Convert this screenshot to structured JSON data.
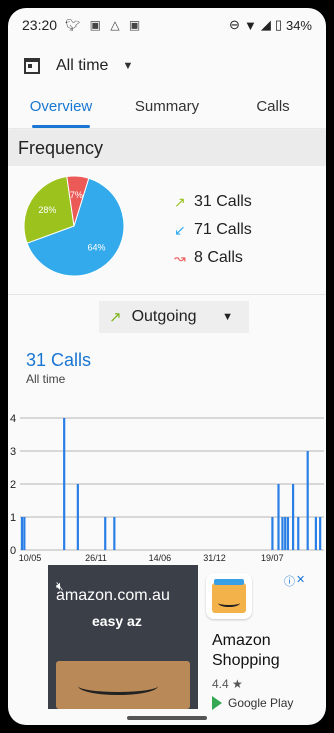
{
  "status_bar": {
    "time": "23:20",
    "notification_icons": [
      "twitter-icon",
      "photos-icon",
      "drive-icon",
      "photos-icon"
    ],
    "battery": "34%"
  },
  "date_filter": {
    "label": "All time"
  },
  "tabs": [
    {
      "label": "Overview",
      "active": true
    },
    {
      "label": "Summary",
      "active": false
    },
    {
      "label": "Calls",
      "active": false
    }
  ],
  "frequency": {
    "title": "Frequency",
    "pie": [
      {
        "label": "64%",
        "value": 64,
        "color": "#33aaec"
      },
      {
        "label": "28%",
        "value": 28,
        "color": "#9bc21d"
      },
      {
        "label": "7%",
        "value": 7,
        "color": "#ec5a58"
      }
    ],
    "legend": [
      {
        "arrow": "↗",
        "color": "#9bc21d",
        "text": "31 Calls"
      },
      {
        "arrow": "↙",
        "color": "#33aaec",
        "text": "71 Calls"
      },
      {
        "arrow": "↝",
        "color": "#ec5a58",
        "text": "8 Calls"
      }
    ]
  },
  "type_filter": {
    "arrow": "↗",
    "label": "Outgoing"
  },
  "calls": {
    "title": "31 Calls",
    "subtitle": "All time"
  },
  "chart_data": {
    "type": "bar",
    "yticks": [
      "0",
      "1",
      "2",
      "3",
      "4"
    ],
    "xticks": [
      "10/05",
      "26/11",
      "14/06",
      "31/12",
      "19/07"
    ],
    "ylim": [
      0,
      4
    ],
    "bars": [
      {
        "pos": 0.6,
        "value": 1
      },
      {
        "pos": 1.4,
        "value": 1
      },
      {
        "pos": 14.5,
        "value": 4
      },
      {
        "pos": 19.0,
        "value": 2
      },
      {
        "pos": 28.0,
        "value": 1
      },
      {
        "pos": 31.0,
        "value": 1
      },
      {
        "pos": 83.0,
        "value": 1
      },
      {
        "pos": 85.0,
        "value": 2
      },
      {
        "pos": 86.3,
        "value": 1
      },
      {
        "pos": 87.2,
        "value": 1
      },
      {
        "pos": 88.1,
        "value": 1
      },
      {
        "pos": 89.8,
        "value": 2
      },
      {
        "pos": 91.5,
        "value": 1
      },
      {
        "pos": 94.6,
        "value": 3
      },
      {
        "pos": 97.3,
        "value": 1
      },
      {
        "pos": 98.7,
        "value": 1
      }
    ],
    "bar_color": "#2a7fe6",
    "grid": true
  },
  "ad": {
    "domain": "amazon.com.au",
    "tagline": "easy az",
    "app_name_line1": "Amazon",
    "app_name_line2": "Shopping",
    "rating": "4.4 ★",
    "store": "Google Play",
    "info": "ⓘ",
    "close": "✕"
  }
}
